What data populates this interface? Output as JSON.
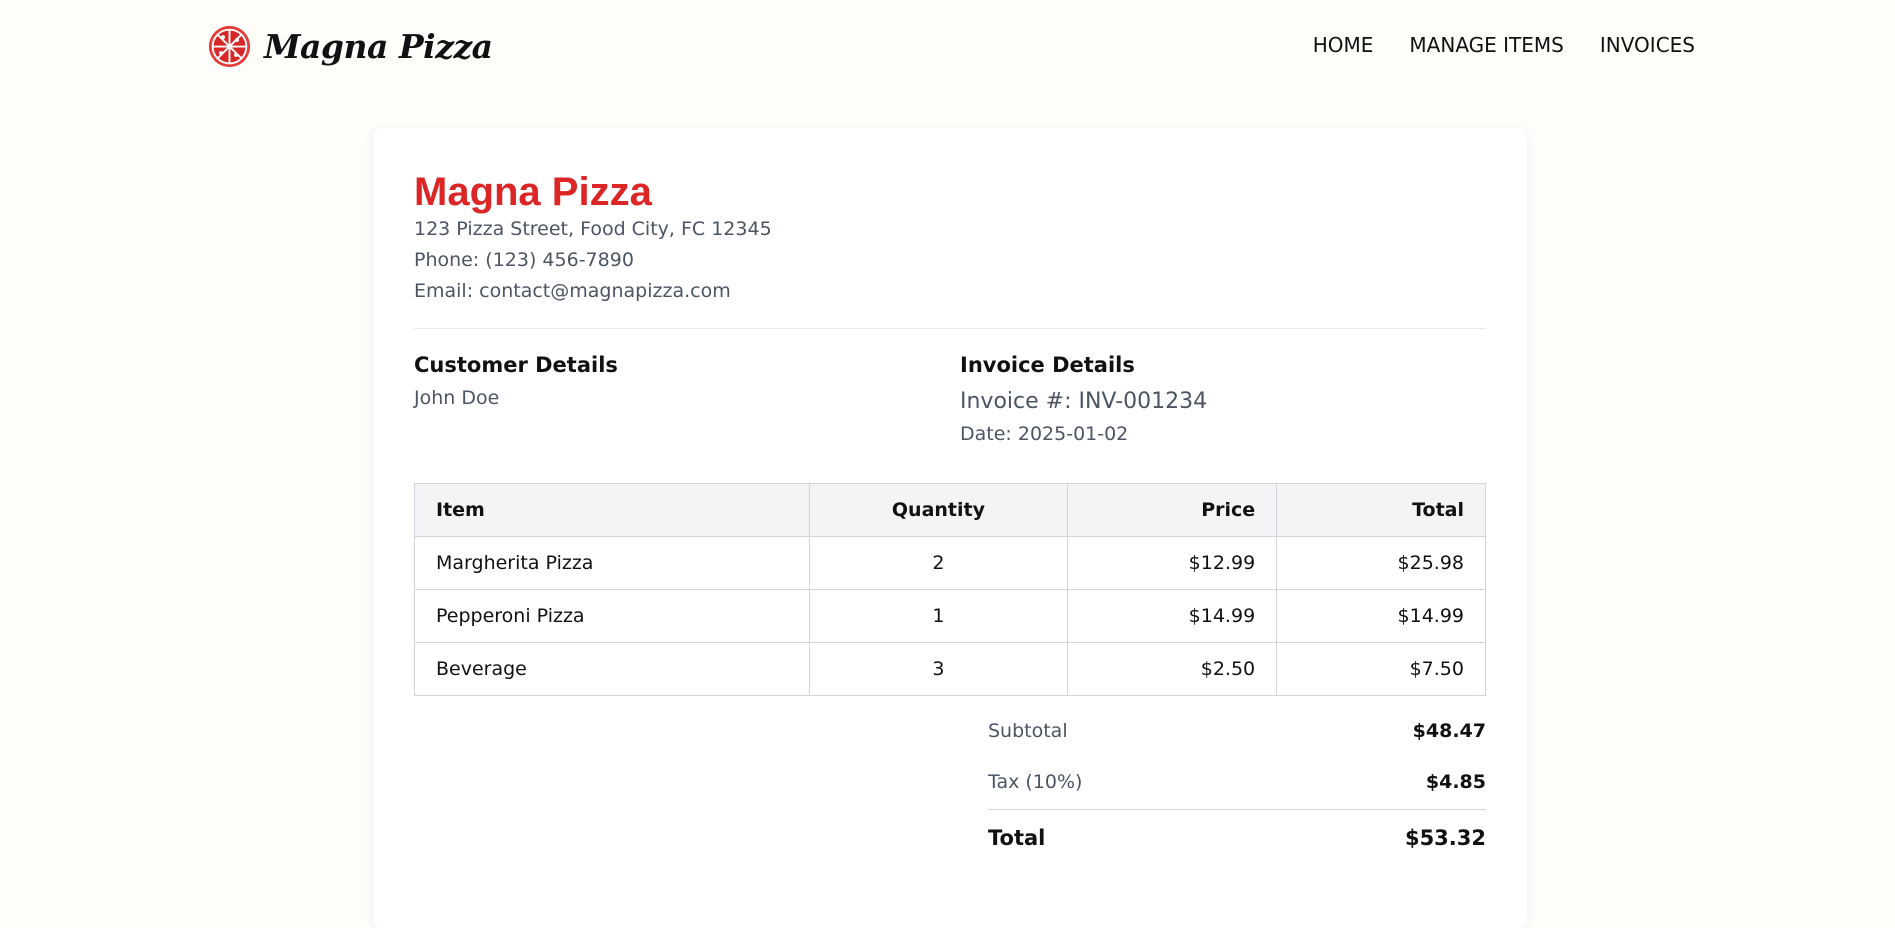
{
  "nav": {
    "brand": "Magna Pizza",
    "links": [
      "HOME",
      "MANAGE ITEMS",
      "INVOICES"
    ]
  },
  "company": {
    "name": "Magna Pizza",
    "address": "123 Pizza Street, Food City, FC 12345",
    "phone": "Phone: (123) 456-7890",
    "email": "Email: contact@magnapizza.com"
  },
  "customer": {
    "title": "Customer Details",
    "name": "John Doe"
  },
  "invoice": {
    "title": "Invoice Details",
    "number": "Invoice #: INV-001234",
    "date": "Date: 2025-01-02"
  },
  "table": {
    "headers": [
      "Item",
      "Quantity",
      "Price",
      "Total"
    ],
    "rows": [
      [
        "Margherita Pizza",
        "2",
        "$12.99",
        "$25.98"
      ],
      [
        "Pepperoni Pizza",
        "1",
        "$14.99",
        "$14.99"
      ],
      [
        "Beverage",
        "3",
        "$2.50",
        "$7.50"
      ]
    ]
  },
  "totals": {
    "subtotal_label": "Subtotal",
    "subtotal_value": "$48.47",
    "tax_label": "Tax (10%)",
    "tax_value": "$4.85",
    "total_label": "Total",
    "total_value": "$53.32"
  },
  "colors": {
    "accent": "#dc2626",
    "page_background": "#fefdf9",
    "muted_text": "#4b5563"
  },
  "icons": {
    "brand_logo": "pizza-icon"
  }
}
